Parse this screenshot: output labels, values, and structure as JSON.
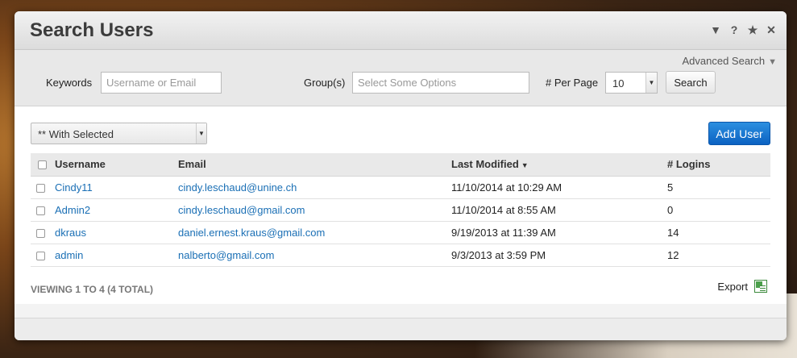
{
  "header": {
    "title": "Search Users",
    "icons": [
      "collapse-icon",
      "help-icon",
      "star-icon",
      "close-icon"
    ]
  },
  "filter": {
    "advanced_search_label": "Advanced Search",
    "keywords_label": "Keywords",
    "keywords_placeholder": "Username or Email",
    "groups_label": "Group(s)",
    "groups_placeholder": "Select Some Options",
    "per_page_label": "# Per Page",
    "per_page_value": "10",
    "search_button": "Search"
  },
  "toolbar": {
    "with_selected_value": "** With Selected",
    "add_user_button": "Add User"
  },
  "table": {
    "columns": [
      "Username",
      "Email",
      "Last Modified",
      "# Logins"
    ],
    "rows": [
      {
        "username": "Cindy11",
        "email": "cindy.leschaud@unine.ch",
        "last_modified": "11/10/2014 at 10:29 AM",
        "logins": "5"
      },
      {
        "username": "Admin2",
        "email": "cindy.leschaud@gmail.com",
        "last_modified": "11/10/2014 at 8:55 AM",
        "logins": "0"
      },
      {
        "username": "dkraus",
        "email": "daniel.ernest.kraus@gmail.com",
        "last_modified": "9/19/2013 at 11:39 AM",
        "logins": "14"
      },
      {
        "username": "admin",
        "email": "nalberto@gmail.com",
        "last_modified": "9/3/2013 at 3:59 PM",
        "logins": "12"
      }
    ]
  },
  "status": {
    "viewing": "VIEWING 1 TO 4 (4 TOTAL)",
    "export_label": "Export"
  },
  "colors": {
    "accent": "#0b62c2",
    "link": "#1a6fb5"
  }
}
